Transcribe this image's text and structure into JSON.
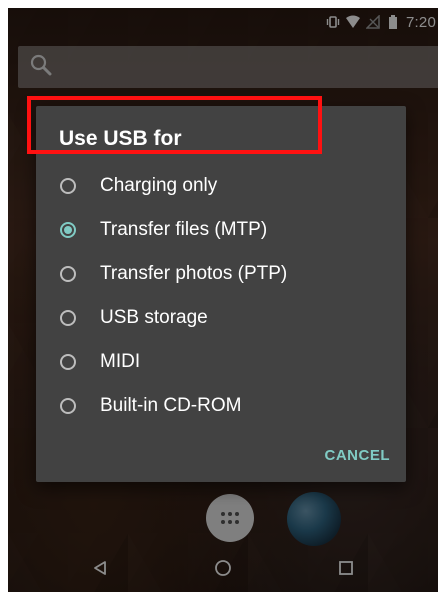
{
  "status_bar": {
    "time": "7:20",
    "icons": [
      "vibrate-icon",
      "wifi-icon",
      "no-sim-icon",
      "battery-icon"
    ]
  },
  "search_bar": {
    "icon": "search-icon"
  },
  "dialog": {
    "title": "Use USB for",
    "options": [
      {
        "label": "Charging only",
        "selected": false
      },
      {
        "label": "Transfer files (MTP)",
        "selected": true
      },
      {
        "label": "Transfer photos (PTP)",
        "selected": false
      },
      {
        "label": "USB storage",
        "selected": false
      },
      {
        "label": "MIDI",
        "selected": false
      },
      {
        "label": "Built-in CD-ROM",
        "selected": false
      }
    ],
    "cancel_label": "CANCEL",
    "accent_color": "#80cbc4"
  },
  "annotation": {
    "highlight_color": "#ff1111",
    "highlighted_option": "Transfer files (MTP)"
  },
  "dock": {
    "items": [
      "app-drawer-icon",
      "browser-globe-icon"
    ]
  },
  "nav_bar": {
    "buttons": [
      "back-icon",
      "home-icon",
      "recents-icon"
    ]
  }
}
